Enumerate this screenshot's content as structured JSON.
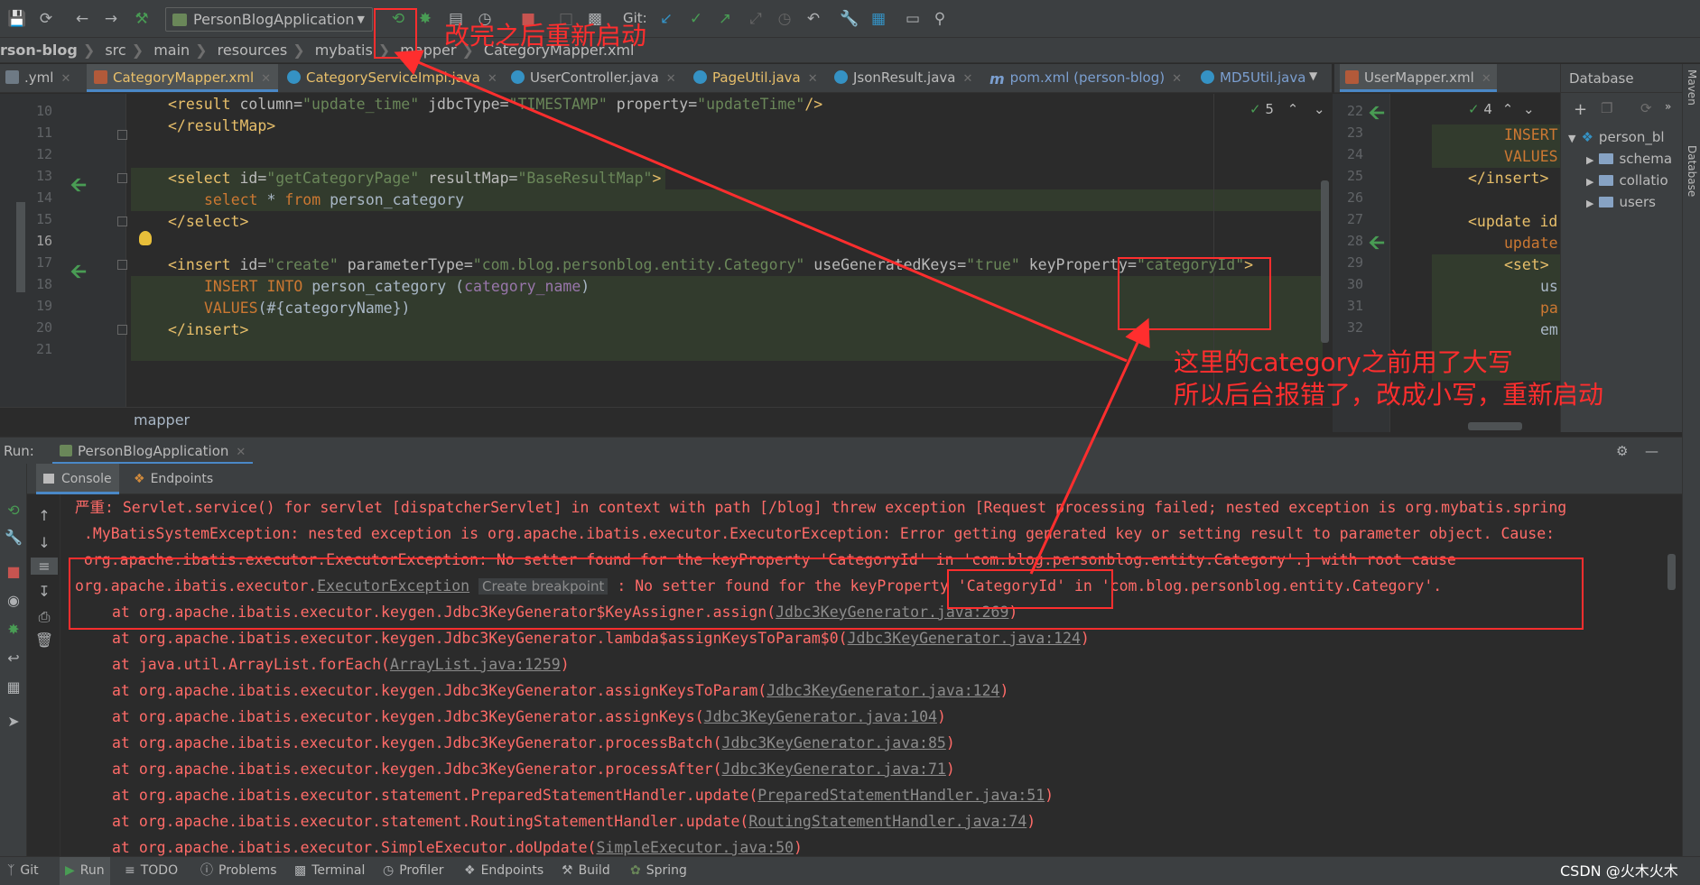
{
  "toolbar": {
    "run_config": "PersonBlogApplication",
    "git_label": "Git:"
  },
  "breadcrumb": [
    "rson-blog",
    "src",
    "main",
    "resources",
    "mybatis",
    "mapper",
    "CategoryMapper.xml"
  ],
  "tabs": [
    {
      "label": ".yml"
    },
    {
      "label": "CategoryMapper.xml"
    },
    {
      "label": "CategoryServiceImpl.java"
    },
    {
      "label": "UserController.java"
    },
    {
      "label": "PageUtil.java"
    },
    {
      "label": "JsonResult.java"
    },
    {
      "label": "pom.xml (person-blog)"
    },
    {
      "label": "MD5Util.java"
    }
  ],
  "right_tab": "UserMapper.xml",
  "editor_main": {
    "inspection_count": "5",
    "line_numbers": [
      "10",
      "11",
      "12",
      "13",
      "14",
      "15",
      "16",
      "17",
      "18",
      "19",
      "20",
      "21"
    ],
    "footer": "mapper"
  },
  "editor_right": {
    "inspection_count": "4",
    "line_numbers": [
      "22",
      "23",
      "24",
      "25",
      "26",
      "27",
      "28",
      "29",
      "30",
      "31",
      "32"
    ],
    "lines": [
      "INSERT",
      "VALUES",
      "</insert>",
      "",
      "<update id",
      "update",
      "<set>",
      "us",
      "pa",
      "em"
    ]
  },
  "database": {
    "title": "Database",
    "root": "person_bl",
    "items": [
      "schema",
      "collatio",
      "users"
    ]
  },
  "right_strip": {
    "maven": "Maven",
    "database": "Database"
  },
  "run_panel": {
    "label": "Run:",
    "app": "PersonBlogApplication",
    "tabs": [
      "Console",
      "Endpoints"
    ],
    "hint": "Create breakpoint",
    "lines": [
      "严重: Servlet.service() for servlet [dispatcherServlet] in context with path [/blog] threw exception [Request processing failed; nested exception is org.mybatis.spring",
      " .MyBatisSystemException: nested exception is org.apache.ibatis.executor.ExecutorException: Error getting generated key or setting result to parameter object. Cause:",
      " org.apache.ibatis.executor.ExecutorException: No setter found for the keyProperty 'CategoryId' in 'com.blog.personblog.entity.Category'.] with root cause"
    ],
    "line4_prefix": "org.apache.ibatis.executor.",
    "line4_link": "ExecutorException",
    "line4_suffix": " : No setter found for the keyProperty 'CategoryId' in 'com.blog.personblog.entity.Category'.",
    "stack": [
      {
        "call": "org.apache.ibatis.executor.keygen.Jdbc3KeyGenerator$KeyAssigner.assign",
        "loc": "Jdbc3KeyGenerator.java:269"
      },
      {
        "call": "org.apache.ibatis.executor.keygen.Jdbc3KeyGenerator.lambda$assignKeysToParam$0",
        "loc": "Jdbc3KeyGenerator.java:124"
      },
      {
        "call": "java.util.ArrayList.forEach",
        "loc": "ArrayList.java:1259"
      },
      {
        "call": "org.apache.ibatis.executor.keygen.Jdbc3KeyGenerator.assignKeysToParam",
        "loc": "Jdbc3KeyGenerator.java:124"
      },
      {
        "call": "org.apache.ibatis.executor.keygen.Jdbc3KeyGenerator.assignKeys",
        "loc": "Jdbc3KeyGenerator.java:104"
      },
      {
        "call": "org.apache.ibatis.executor.keygen.Jdbc3KeyGenerator.processBatch",
        "loc": "Jdbc3KeyGenerator.java:85"
      },
      {
        "call": "org.apache.ibatis.executor.keygen.Jdbc3KeyGenerator.processAfter",
        "loc": "Jdbc3KeyGenerator.java:71"
      },
      {
        "call": "org.apache.ibatis.executor.statement.PreparedStatementHandler.update",
        "loc": "PreparedStatementHandler.java:51"
      },
      {
        "call": "org.apache.ibatis.executor.statement.RoutingStatementHandler.update",
        "loc": "RoutingStatementHandler.java:74"
      },
      {
        "call": "org.apache.ibatis.executor.SimpleExecutor.doUpdate",
        "loc": "SimpleExecutor.java:50"
      }
    ]
  },
  "statusbar": {
    "items": [
      "Git",
      "Run",
      "TODO",
      "Problems",
      "Terminal",
      "Profiler",
      "Endpoints",
      "Build",
      "Spring"
    ],
    "watermark": "CSDN @火木火木"
  },
  "annotations": {
    "top": "改完之后重新启动",
    "side": "这里的category之前用了大写\n所以后台报错了，改成小写，重新启动"
  },
  "colors": {
    "annotation": "#ff2e2e",
    "console_error": "#ff6b68",
    "xml_tag": "#e8bf6a",
    "xml_value": "#6a8759",
    "sql_keyword": "#cc7832"
  }
}
